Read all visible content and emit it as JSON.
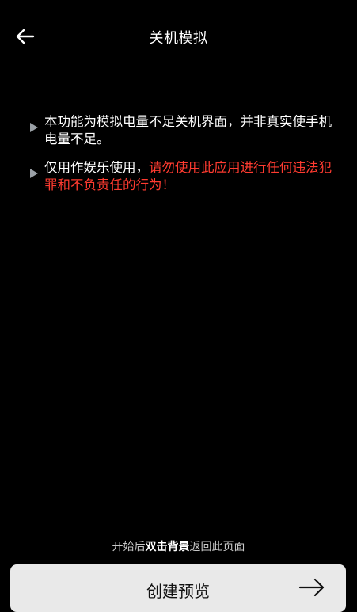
{
  "header": {
    "title": "关机模拟",
    "back_icon": "arrow-left-icon"
  },
  "notes": [
    {
      "text": "本功能为模拟电量不足关机界面，并非真实使手机电量不足。",
      "warning": ""
    },
    {
      "text": "仅用作娱乐使用，",
      "warning": "请勿使用此应用进行任何违法犯罪和不负责任的行为！"
    }
  ],
  "hint": {
    "prefix": "开始后",
    "emphasis": "双击背景",
    "suffix": "返回此页面"
  },
  "preview_button": {
    "label": "创建预览",
    "icon": "arrow-right-icon"
  },
  "colors": {
    "background": "#000000",
    "warning": "#ff3b30",
    "button_bg": "#e9e9e9"
  }
}
